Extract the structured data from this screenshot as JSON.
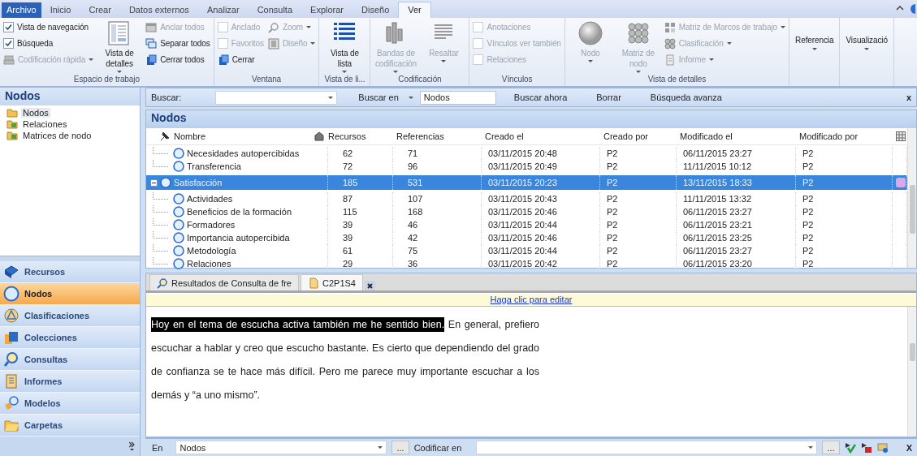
{
  "menu_tabs": [
    {
      "label": "Archivo",
      "kind": "file",
      "selected": false
    },
    {
      "label": "Inicio",
      "kind": "tab",
      "selected": false
    },
    {
      "label": "Crear",
      "kind": "tab",
      "selected": false
    },
    {
      "label": "Datos externos",
      "kind": "tab",
      "selected": false
    },
    {
      "label": "Analizar",
      "kind": "tab",
      "selected": false
    },
    {
      "label": "Consulta",
      "kind": "tab",
      "selected": false
    },
    {
      "label": "Explorar",
      "kind": "tab",
      "selected": false
    },
    {
      "label": "Diseño",
      "kind": "tab",
      "selected": false
    },
    {
      "label": "Ver",
      "kind": "tab",
      "selected": true
    }
  ],
  "ribbon": {
    "groups": [
      {
        "label": "Espacio de trabajo",
        "columns": [
          [
            {
              "kind": "check",
              "label": "Vista de navegación",
              "checked": true,
              "disabled": false
            },
            {
              "kind": "check",
              "label": "Búsqueda",
              "checked": true,
              "disabled": false
            },
            {
              "kind": "small",
              "label": "Codificación rápida",
              "disabled": true,
              "dropdown": true
            }
          ],
          [
            {
              "kind": "large",
              "label": "Vista de detalles",
              "disabled": false,
              "dropdown": true
            }
          ],
          [
            {
              "kind": "small",
              "label": "Anclar todos",
              "disabled": true,
              "dropdown": false
            },
            {
              "kind": "small",
              "label": "Separar todos",
              "disabled": false,
              "dropdown": false
            },
            {
              "kind": "small",
              "label": "Cerrar todos",
              "disabled": false,
              "dropdown": false
            }
          ]
        ]
      },
      {
        "label": "Ventana",
        "columns": [
          [
            {
              "kind": "check",
              "label": "Anclado",
              "checked": false,
              "disabled": true
            },
            {
              "kind": "check",
              "label": "Favoritos",
              "checked": false,
              "disabled": true
            },
            {
              "kind": "small",
              "label": "Cerrar",
              "disabled": false,
              "dropdown": false
            }
          ],
          [
            {
              "kind": "small",
              "label": "Zoom",
              "disabled": true,
              "dropdown": true
            },
            {
              "kind": "small",
              "label": "Diseño",
              "disabled": true,
              "dropdown": true
            }
          ]
        ]
      },
      {
        "label": "Vista de li...",
        "columns": [
          [
            {
              "kind": "large",
              "label": "Vista de lista",
              "disabled": false,
              "dropdown": true
            }
          ]
        ]
      },
      {
        "label": "Codificación",
        "columns": [
          [
            {
              "kind": "large",
              "label": "Bandas de codificación",
              "disabled": true,
              "dropdown": true
            }
          ],
          [
            {
              "kind": "large",
              "label": "Resaltar",
              "disabled": true,
              "dropdown": true
            }
          ]
        ]
      },
      {
        "label": "Vínculos",
        "columns": [
          [
            {
              "kind": "check",
              "label": "Anotaciones",
              "checked": false,
              "disabled": true
            },
            {
              "kind": "check",
              "label": "Vínculos ver también",
              "checked": false,
              "disabled": true
            },
            {
              "kind": "check",
              "label": "Relaciones",
              "checked": false,
              "disabled": true
            }
          ]
        ]
      },
      {
        "label": "Vista de detalles",
        "columns": [
          [
            {
              "kind": "large",
              "label": "Nodo",
              "disabled": true,
              "dropdown": true
            }
          ],
          [
            {
              "kind": "large",
              "label": "Matriz de nodo",
              "disabled": true,
              "dropdown": true
            }
          ],
          [
            {
              "kind": "small",
              "label": "Matriz de Marcos de trabajo",
              "disabled": true,
              "dropdown": true
            },
            {
              "kind": "small",
              "label": "Clasificación",
              "disabled": true,
              "dropdown": true
            },
            {
              "kind": "small",
              "label": "Informe",
              "disabled": true,
              "dropdown": true
            }
          ]
        ]
      },
      {
        "columns": [
          [
            {
              "kind": "menu",
              "label": "Referencia",
              "disabled": false,
              "dropdown": true
            }
          ]
        ]
      },
      {
        "columns": [
          [
            {
              "kind": "menu",
              "label": "Visualizació",
              "disabled": false,
              "dropdown": true
            }
          ]
        ]
      }
    ]
  },
  "sidebar": {
    "title": "Nodos",
    "tree": [
      {
        "label": "Nodos",
        "selected": true
      },
      {
        "label": "Relaciones",
        "selected": false
      },
      {
        "label": "Matrices de nodo",
        "selected": false
      }
    ],
    "nav": [
      {
        "label": "Recursos",
        "selected": false
      },
      {
        "label": "Nodos",
        "selected": true
      },
      {
        "label": "Clasificaciones",
        "selected": false
      },
      {
        "label": "Colecciones",
        "selected": false
      },
      {
        "label": "Consultas",
        "selected": false
      },
      {
        "label": "Informes",
        "selected": false
      },
      {
        "label": "Modelos",
        "selected": false
      },
      {
        "label": "Carpetas",
        "selected": false
      }
    ]
  },
  "search_bar": {
    "label": "Buscar:",
    "scope_label": "Buscar en",
    "scope_value": "Nodos",
    "buttons": [
      "Buscar ahora",
      "Borrar",
      "Búsqueda avanza"
    ],
    "close": "x"
  },
  "table": {
    "title": "Nodos",
    "columns": [
      "Nombre",
      "Recursos",
      "Referencias",
      "Creado el",
      "Creado por",
      "Modificado el",
      "Modificado por"
    ],
    "rows": [
      {
        "children": [
          {
            "cells": [
              "Necesidades autopercibidas",
              "62",
              "71",
              "03/11/2015 20:48",
              "P2",
              "06/11/2015 23:27",
              "P2"
            ],
            "selected": false
          },
          {
            "cells": [
              "Transferencia",
              "72",
              "96",
              "03/11/2015 20:49",
              "P2",
              "11/11/2015 10:12",
              "P2"
            ],
            "selected": false
          }
        ]
      },
      {
        "cells": [
          "Satisfacción",
          "185",
          "531",
          "03/11/2015 20:23",
          "P2",
          "13/11/2015 18:33",
          "P2"
        ],
        "selected": true,
        "expanded": true,
        "color": "#d9a8e8",
        "children": [
          {
            "cells": [
              "Actividades",
              "87",
              "107",
              "03/11/2015 20:43",
              "P2",
              "11/11/2015 13:32",
              "P2"
            ],
            "selected": false
          },
          {
            "cells": [
              "Beneficios de la formación",
              "115",
              "168",
              "03/11/2015 20:46",
              "P2",
              "06/11/2015 23:27",
              "P2"
            ],
            "selected": false
          },
          {
            "cells": [
              "Formadores",
              "39",
              "46",
              "03/11/2015 20:44",
              "P2",
              "06/11/2015 23:21",
              "P2"
            ],
            "selected": false
          },
          {
            "cells": [
              "Importancia autopercibida",
              "39",
              "42",
              "03/11/2015 20:46",
              "P2",
              "06/11/2015 23:25",
              "P2"
            ],
            "selected": false
          },
          {
            "cells": [
              "Metodología",
              "61",
              "75",
              "03/11/2015 20:44",
              "P2",
              "06/11/2015 23:27",
              "P2"
            ],
            "selected": false
          },
          {
            "cells": [
              "Relaciones",
              "29",
              "36",
              "03/11/2015 20:42",
              "P2",
              "06/11/2015 23:20",
              "P2"
            ],
            "selected": false
          }
        ]
      }
    ]
  },
  "doc_tabs": [
    {
      "label": "Resultados de Consulta de fre",
      "selected": false
    },
    {
      "label": "C2P1S4",
      "selected": true
    }
  ],
  "document": {
    "edit_link": "Haga clic para editar",
    "paragraph": [
      {
        "text": "Hoy en el tema de escucha activa también me he sentido bien.",
        "highlighted": true
      },
      {
        "text": " En general, prefiero escuchar a hablar y creo que escucho bastante. Es cierto que dependiendo del grado de confianza se te hace más difícil. Pero me parece muy importante escuchar a los demás y “a uno mismo”.",
        "highlighted": false
      }
    ]
  },
  "coding_bar": {
    "in_label": "En",
    "in_value": "Nodos",
    "browse": "...",
    "code_label": "Codificar en",
    "code_browse": "...",
    "close": "X"
  }
}
